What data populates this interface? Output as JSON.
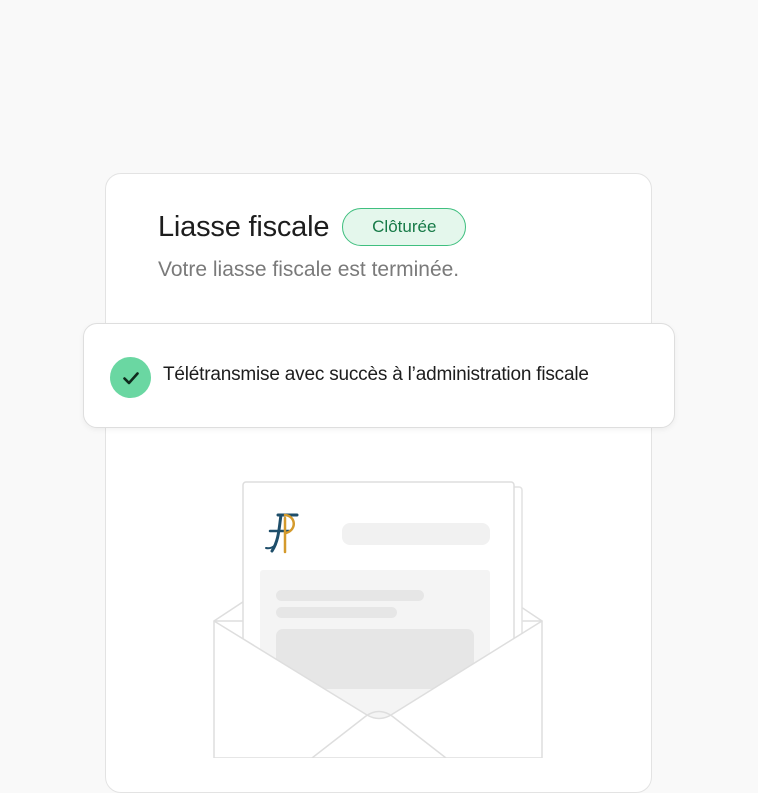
{
  "card": {
    "title": "Liasse fiscale",
    "status_badge": "Clôturée",
    "subtitle": "Votre liasse fiscale est terminée."
  },
  "notice": {
    "icon": "check-icon",
    "text": "Télétransmise avec succès à l’administration fiscale"
  },
  "illustration": {
    "document_logo": "finances-publiques-logo",
    "envelope_icon": "envelope-icon"
  },
  "colors": {
    "background": "#f9f9f9",
    "badge_border": "#3fbf7f",
    "badge_background": "#e4f7ec",
    "badge_text": "#167a47",
    "check_circle": "#6ad7a2"
  }
}
